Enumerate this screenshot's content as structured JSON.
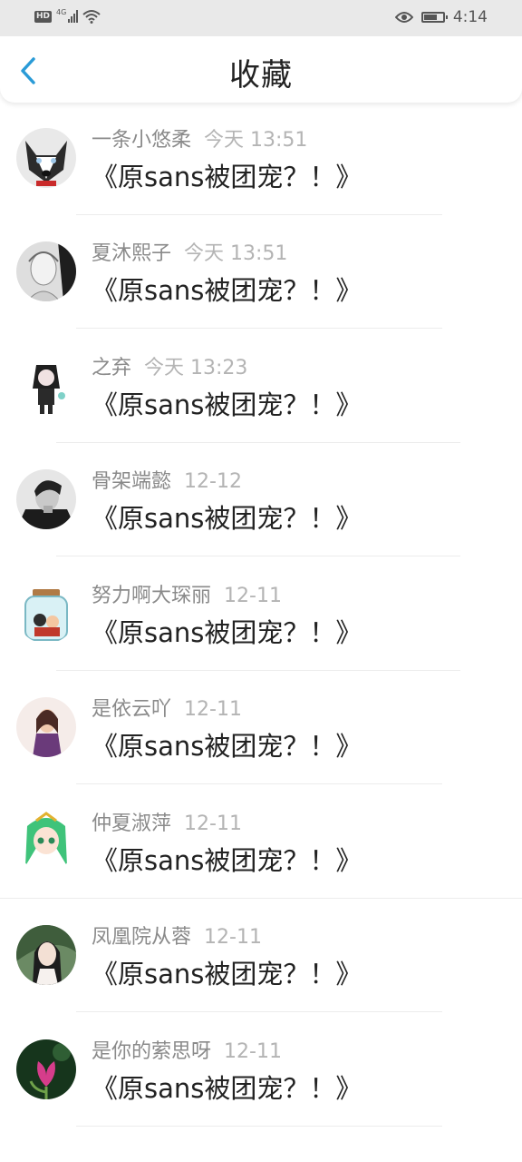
{
  "status_bar": {
    "network": "4G",
    "hd": "HD",
    "time": "4:14",
    "battery_level": 0.75
  },
  "header": {
    "title": "收藏",
    "back_icon": "chevron-left-icon",
    "accent_color": "#2a9bd7"
  },
  "items": [
    {
      "user": "",
      "time": "",
      "title": "《原sans被团宠？！》",
      "avatar": "partial"
    },
    {
      "user": "一条小悠柔",
      "time": "今天 13:51",
      "title": "《原sans被团宠？！》",
      "avatar": "husky"
    },
    {
      "user": "夏沐熙子",
      "time": "今天 13:51",
      "title": "《原sans被团宠？！》",
      "avatar": "sketch"
    },
    {
      "user": "之弃",
      "time": "今天 13:23",
      "title": "《原sans被团宠？！》",
      "avatar": "figure"
    },
    {
      "user": "骨架端懿",
      "time": "12-12",
      "title": "《原sans被团宠？！》",
      "avatar": "man"
    },
    {
      "user": "努力啊大琛丽",
      "time": "12-11",
      "title": "《原sans被团宠？！》",
      "avatar": "jar"
    },
    {
      "user": "是依云吖",
      "time": "12-11",
      "title": "《原sans被团宠？！》",
      "avatar": "girl"
    },
    {
      "user": "仲夏淑萍",
      "time": "12-11",
      "title": "《原sans被团宠？！》",
      "avatar": "anime"
    },
    {
      "user": "凤凰院从蓉",
      "time": "12-11",
      "title": "《原sans被团宠？！》",
      "avatar": "portrait"
    },
    {
      "user": "是你的萦思呀",
      "time": "12-11",
      "title": "《原sans被团宠？！》",
      "avatar": "flower"
    }
  ]
}
